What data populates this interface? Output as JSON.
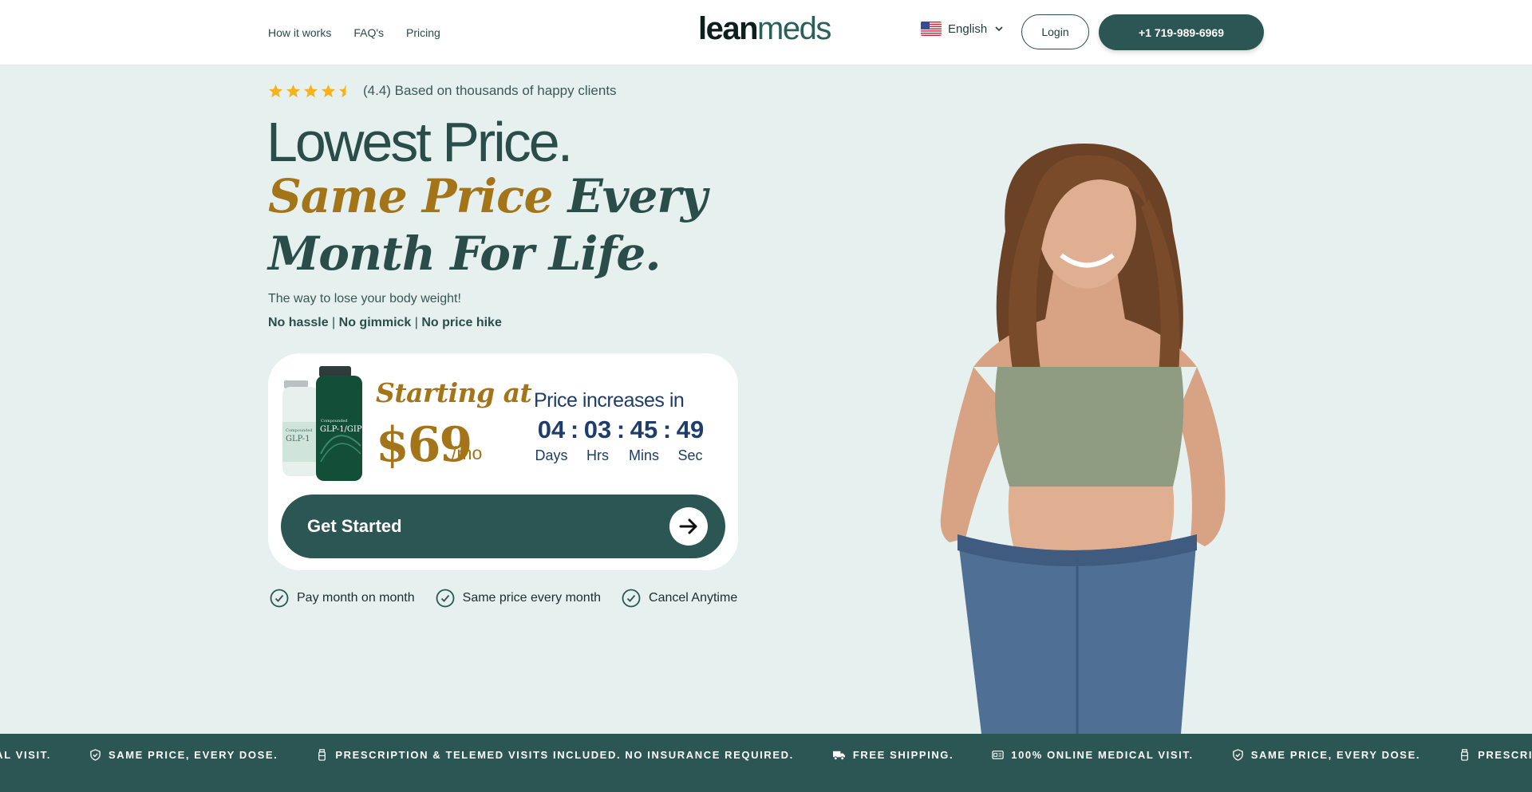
{
  "nav": {
    "links": [
      "How it works",
      "FAQ's",
      "Pricing"
    ]
  },
  "logo": {
    "part1": "lean",
    "part2": "meds"
  },
  "language": {
    "label": "English"
  },
  "header": {
    "login_label": "Login",
    "phone_label": "+1 719-989-6969"
  },
  "hero": {
    "rating_text": "(4.4) Based on thousands of happy clients",
    "rating_value": 4.4,
    "headline_line1": "Lowest Price.",
    "headline_gold": "Same Price",
    "headline_rest": " Every",
    "headline_line3": "Month For Life.",
    "subtitle": "The way to lose your body weight!",
    "tagline": {
      "a": "No hassle",
      "sep1": " | ",
      "b": "No gimmick",
      "sep2": " | ",
      "c": "No price hike"
    }
  },
  "price_card": {
    "starting_label": "Starting at",
    "price": "$69",
    "per": "/mo",
    "vial_small_label": "GLP-1",
    "vial_large_label": "GLP-1/GIP",
    "countdown_label": "Price increases in",
    "countdown": [
      {
        "value": "04",
        "unit": "Days"
      },
      {
        "value": "03",
        "unit": "Hrs"
      },
      {
        "value": "45",
        "unit": "Mins"
      },
      {
        "value": "49",
        "unit": "Sec"
      }
    ],
    "cta_label": "Get Started"
  },
  "benefits": [
    "Pay month on month",
    "Same price every month",
    "Cancel Anytime"
  ],
  "marquee": {
    "items": [
      {
        "icon": "id-card-icon",
        "text": "ICAL VISIT."
      },
      {
        "icon": "shield-check-icon",
        "text": "SAME PRICE, EVERY DOSE."
      },
      {
        "icon": "bottle-icon",
        "text": "PRESCRIPTION & TELEMED VISITS INCLUDED. NO INSURANCE REQUIRED."
      },
      {
        "icon": "truck-icon",
        "text": "FREE SHIPPING."
      },
      {
        "icon": "id-card-icon",
        "text": "100% ONLINE MEDICAL VISIT."
      },
      {
        "icon": "shield-check-icon",
        "text": "SAME PRICE, EVERY DOSE."
      },
      {
        "icon": "bottle-icon",
        "text": "PRESCRIPTION & T"
      }
    ]
  },
  "colors": {
    "brand_green": "#2c5654",
    "gold": "#a47418",
    "background": "#e6f1ef",
    "star": "#f5b21b"
  }
}
